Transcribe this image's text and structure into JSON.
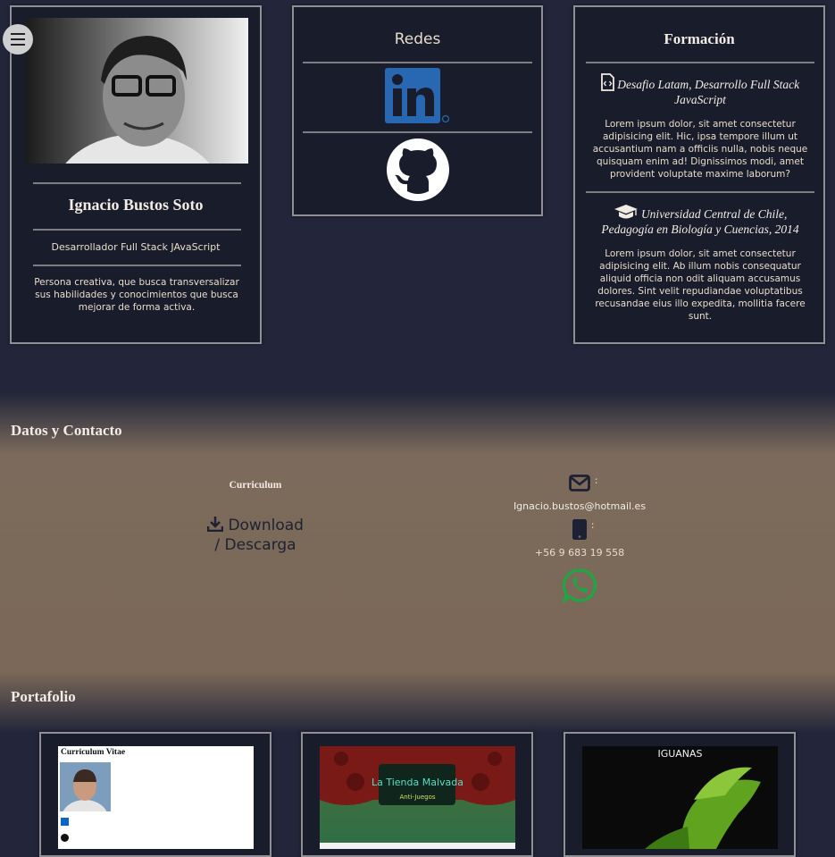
{
  "menu": {
    "icon": "hamburger-icon"
  },
  "profile": {
    "name": "Ignacio Bustos Soto",
    "role": "Desarrollador Full Stack JAvaScript",
    "bio": "Persona creativa, que busca transversalizar sus habilidades y conocimientos que busca mejorar de forma activa."
  },
  "redes": {
    "title": "Redes",
    "items": [
      {
        "name": "LinkedIn",
        "icon": "linkedin-icon",
        "color": "#0a66c2"
      },
      {
        "name": "GitHub",
        "icon": "github-icon",
        "color": "#ffffff"
      }
    ]
  },
  "formacion": {
    "title": "Formación",
    "items": [
      {
        "icon": "code-file-icon",
        "title": "Desafio Latam, Desarrollo Full Stack JavaScript",
        "text": "Lorem ipsum dolor, sit amet consectetur adipisicing elit. Hic, ipsa tempore illum ut accusantium nam a officiis nulla, nobis neque quisquam enim ad! Dignissimos modi, amet provident voluptate maxime laborum?"
      },
      {
        "icon": "graduation-cap-icon",
        "title": "Universidad Central de Chile, Pedagogía en Biología y Cuencias, 2014",
        "text": "Lorem ipsum dolor, sit amet consectetur adipisicing elit. Ab illum nobis consequatur aliquid officia non odit aliquam accusamus dolores. Sint velit repudiandae voluptatibus recusandae eius illo expedita, mollitia facere sunt."
      }
    ]
  },
  "contact": {
    "title": "Datos y Contacto",
    "cv_label": "Curriculum",
    "download_label": "Download",
    "download_label2": "/ Descarga",
    "email_sep": ":",
    "email": "Ignacio.bustos@hotmail.es",
    "phone_sep": ":",
    "phone": "+56 9 683 19 558",
    "whatsapp_color": "#25a244"
  },
  "portfolio": {
    "title": "Portafolio",
    "items": [
      {
        "heading": "Curriculum Vitae"
      },
      {
        "heading": "La Tienda Malvada",
        "sub": "Anti-Juegos"
      },
      {
        "heading": "IGUANAS"
      }
    ]
  }
}
